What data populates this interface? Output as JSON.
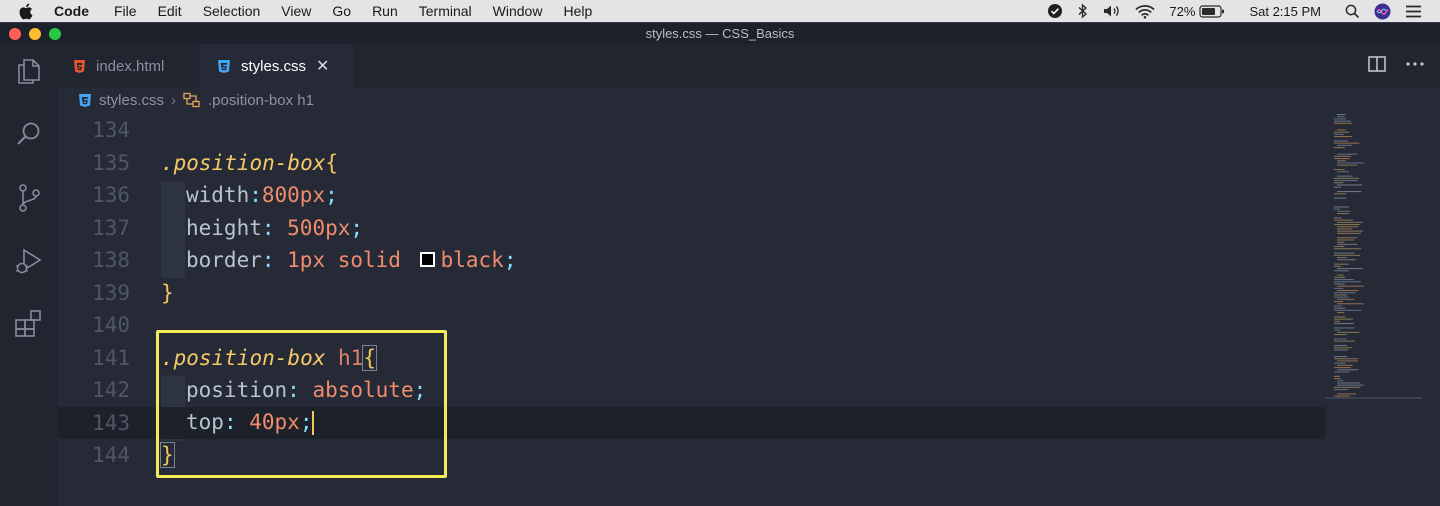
{
  "menubar": {
    "app_name": "Code",
    "items": [
      "File",
      "Edit",
      "Selection",
      "View",
      "Go",
      "Run",
      "Terminal",
      "Window",
      "Help"
    ],
    "battery": "72%",
    "clock": "Sat 2:15 PM"
  },
  "window": {
    "title": "styles.css — CSS_Basics"
  },
  "tabs": [
    {
      "label": "index.html",
      "icon": "html5-icon",
      "active": false
    },
    {
      "label": "styles.css",
      "icon": "css3-icon",
      "active": true
    }
  ],
  "breadcrumb": {
    "file": "styles.css",
    "symbol": ".position-box h1"
  },
  "editor": {
    "line_numbers": [
      "134",
      "135",
      "136",
      "137",
      "138",
      "139",
      "140",
      "141",
      "142",
      "143",
      "144"
    ],
    "current_line": "143",
    "code": {
      "l135_selector": ".position-box",
      "l135_brace": "{",
      "l136_prop": "width",
      "l136_colon": ":",
      "l136_val": "800px",
      "l136_semi": ";",
      "l137_prop": "height",
      "l137_colon": ": ",
      "l137_val": "500px",
      "l137_semi": ";",
      "l138_prop": "border",
      "l138_colon": ": ",
      "l138_val1": "1px solid ",
      "l138_val2": "black",
      "l138_semi": ";",
      "l139_brace": "}",
      "l141_selector": ".position-box",
      "l141_tag": " h1",
      "l141_brace": "{",
      "l142_prop": "position",
      "l142_colon": ": ",
      "l142_val": "absolute",
      "l142_semi": ";",
      "l143_prop": "top",
      "l143_colon": ": ",
      "l143_val": "40px",
      "l143_semi": ";",
      "l144_brace": "}"
    },
    "swatch_color": "#000000"
  },
  "colors": {
    "editor_bg": "#252a36",
    "highlight_box": "#f2ec57",
    "selector": "#f5c965",
    "value": "#f08c6b"
  }
}
